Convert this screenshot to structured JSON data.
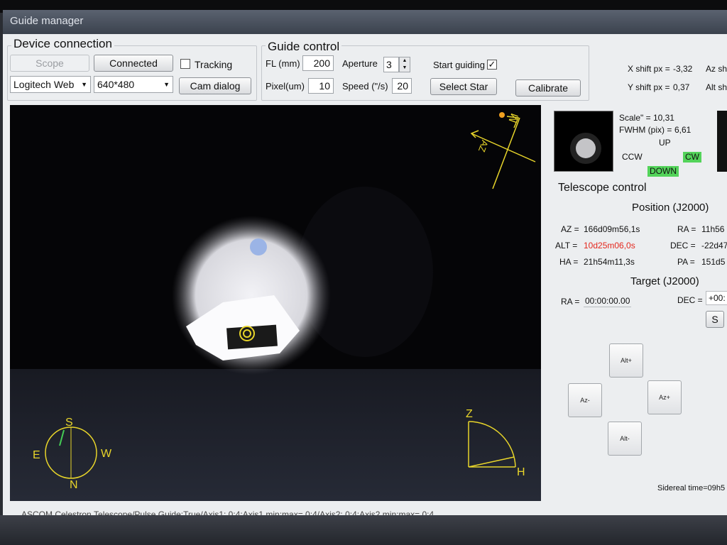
{
  "window": {
    "title": "Guide manager"
  },
  "device_connection": {
    "title": "Device connection",
    "scope_label": "Scope",
    "connected_label": "Connected",
    "tracking_label": "Tracking",
    "tracking_checked": false,
    "camera_value": "Logitech Web",
    "resolution_value": "640*480",
    "cam_dialog_label": "Cam dialog"
  },
  "guide_control": {
    "title": "Guide control",
    "fl_label": "FL (mm)",
    "fl_value": "200",
    "aperture_label": "Aperture",
    "aperture_value": "3",
    "pixel_label": "Pixel(um)",
    "pixel_value": "10",
    "speed_label": "Speed (\"/s)",
    "speed_value": "20",
    "start_guiding_label": "Start guiding",
    "start_guiding_checked": true,
    "select_star_label": "Select Star",
    "calibrate_label": "Calibrate"
  },
  "shift_readout": {
    "x_label": "X shift px =",
    "x_value": "-3,32",
    "y_label": "Y shift px =",
    "y_value": "0,37",
    "az_label": "Az shi",
    "alt_label": "Alt shi"
  },
  "star_info": {
    "scale": "Scale\" = 10,31",
    "fwhm_label": "FWHM (pix) =",
    "fwhm_value": "6,61",
    "up": "UP",
    "ccw": "CCW",
    "cw": "CW",
    "down": "DOWN"
  },
  "telescope_control": {
    "title": "Telescope control",
    "position_title": "Position (J2000)",
    "az_label": "AZ =",
    "az_value": "166d09m56,1s",
    "alt_label": "ALT =",
    "alt_value": "10d25m06,0s",
    "ha_label": "HA =",
    "ha_value": "21h54m11,3s",
    "ra_label": "RA =",
    "ra_value": "11h56",
    "dec_label": "DEC =",
    "dec_value": "-22d47",
    "pa_label": "PA =",
    "pa_value": "151d5",
    "target_title": "Target (J2000)",
    "target_ra_label": "RA =",
    "target_ra_value": "00:00:00.00",
    "target_dec_label": "DEC =",
    "target_dec_value": "+00:",
    "s_button_label": "S",
    "alt_plus": "Alt+",
    "alt_minus": "Alt-",
    "az_plus": "Az+",
    "az_minus": "Az-"
  },
  "overlay": {
    "north_label": "N",
    "south_label": "S",
    "east_label": "E",
    "west_label": "W",
    "z_label": "Z",
    "h_label": "H",
    "mount_m_label": "M",
    "mount_az_label": "AZ"
  },
  "sidereal": "Sidereal time=09h5",
  "status": "ASCOM.Celestron.Telescope/Pulse Guide:True/Axis1: 0;4;Axis1 min;max= 0;4/Axis2: 0;4;Axis2 min;max= 0;4",
  "colors": {
    "overlay_yellow": "#e8d52a",
    "active_green": "#53d35a",
    "alert_red": "#e4271d"
  }
}
